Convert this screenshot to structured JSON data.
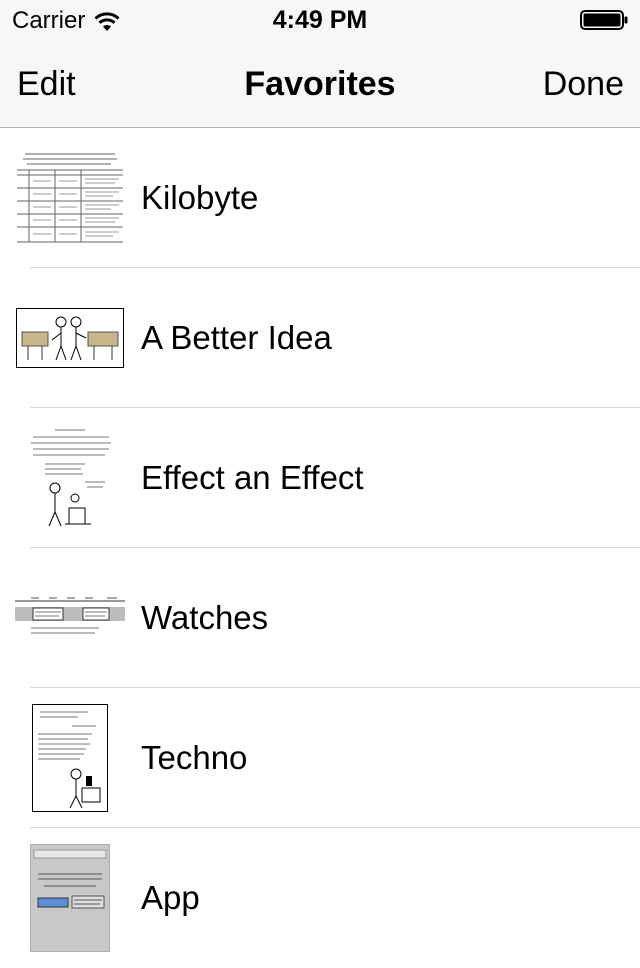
{
  "status_bar": {
    "carrier": "Carrier",
    "time": "4:49 PM"
  },
  "nav": {
    "edit_label": "Edit",
    "title": "Favorites",
    "done_label": "Done"
  },
  "favorites": [
    {
      "title": "Kilobyte"
    },
    {
      "title": "A Better Idea"
    },
    {
      "title": "Effect an Effect"
    },
    {
      "title": "Watches"
    },
    {
      "title": "Techno"
    },
    {
      "title": "App"
    }
  ]
}
